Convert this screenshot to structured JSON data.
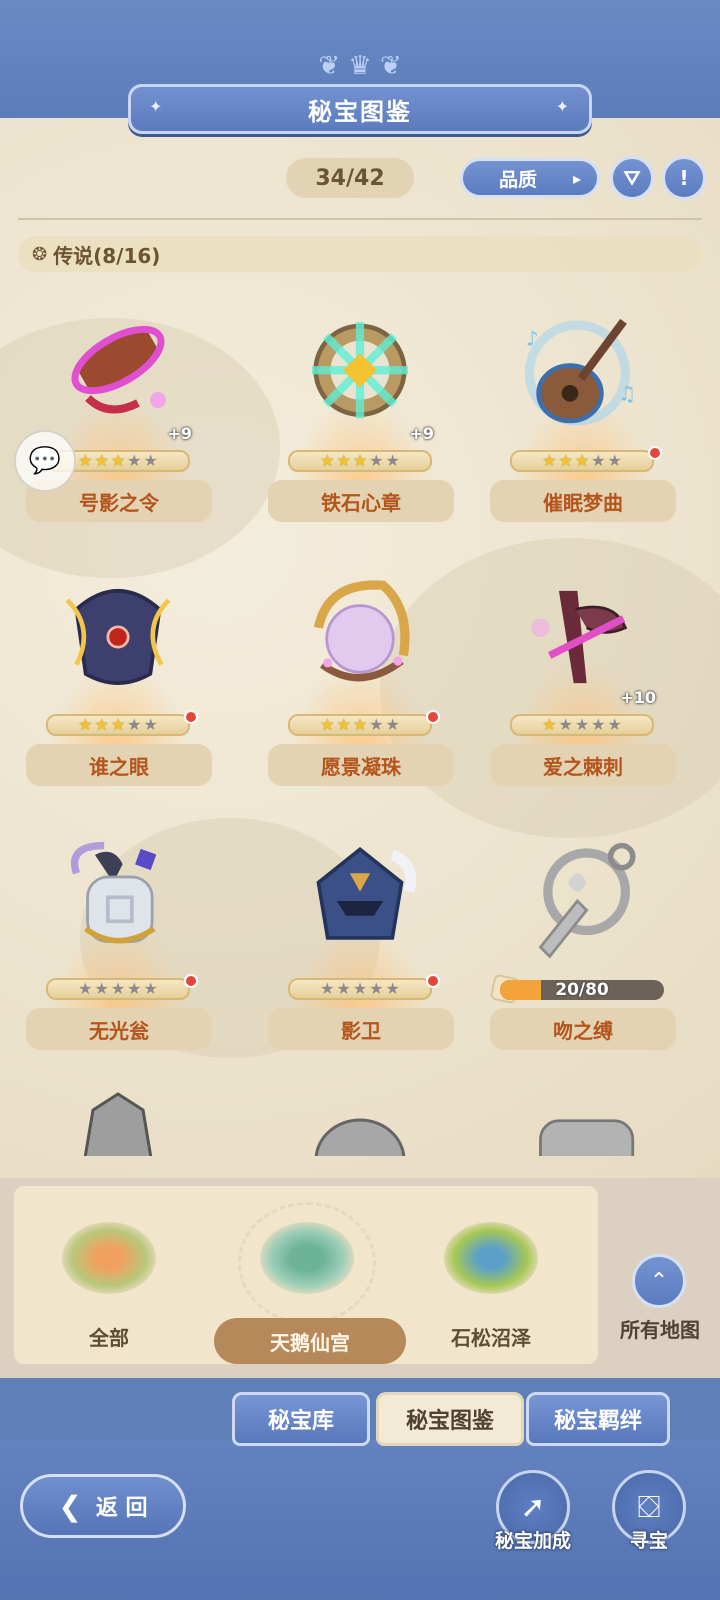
{
  "header": {
    "title": "秘宝图鉴",
    "counter": "34/42",
    "quality_label": "品质",
    "filter_icon": "filter-icon",
    "info_icon": "info-icon"
  },
  "category": {
    "label": "传说(8/16)",
    "icon": "legend-icon"
  },
  "items": [
    {
      "name": "号影之令",
      "stars": 3,
      "max_stars": 5,
      "plus": "+9",
      "dot": false
    },
    {
      "name": "铁石心章",
      "stars": 3,
      "max_stars": 5,
      "plus": "+9",
      "dot": false
    },
    {
      "name": "催眠梦曲",
      "stars": 3,
      "max_stars": 5,
      "plus": "",
      "dot": true
    },
    {
      "name": "谁之眼",
      "stars": 3,
      "max_stars": 5,
      "plus": "",
      "dot": true
    },
    {
      "name": "愿景凝珠",
      "stars": 3,
      "max_stars": 5,
      "plus": "",
      "dot": true
    },
    {
      "name": "爱之棘刺",
      "stars": 1,
      "max_stars": 5,
      "plus": "+10",
      "dot": false
    },
    {
      "name": "无光瓮",
      "stars": 0,
      "max_stars": 5,
      "plus": "",
      "dot": true
    },
    {
      "name": "影卫",
      "stars": 0,
      "max_stars": 5,
      "plus": "",
      "dot": true
    },
    {
      "name": "吻之缚",
      "progress": "20/80",
      "progress_fraction": 0.25
    }
  ],
  "maps": [
    {
      "label": "全部",
      "selected": false
    },
    {
      "label": "天鹅仙宫",
      "selected": true
    },
    {
      "label": "石松沼泽",
      "selected": false
    }
  ],
  "all_maps_label": "所有地图",
  "tabs": [
    {
      "label": "秘宝库",
      "active": false
    },
    {
      "label": "秘宝图鉴",
      "active": true
    },
    {
      "label": "秘宝羁绊",
      "active": false
    }
  ],
  "footer": {
    "back_label": "返 回",
    "enhance_label": "秘宝加成",
    "treasure_label": "寻宝"
  },
  "colors": {
    "accent_blue": "#5f7fb8",
    "name_text": "#b4551c",
    "star_on": "#f2c230",
    "notify_dot": "#e5453a"
  }
}
